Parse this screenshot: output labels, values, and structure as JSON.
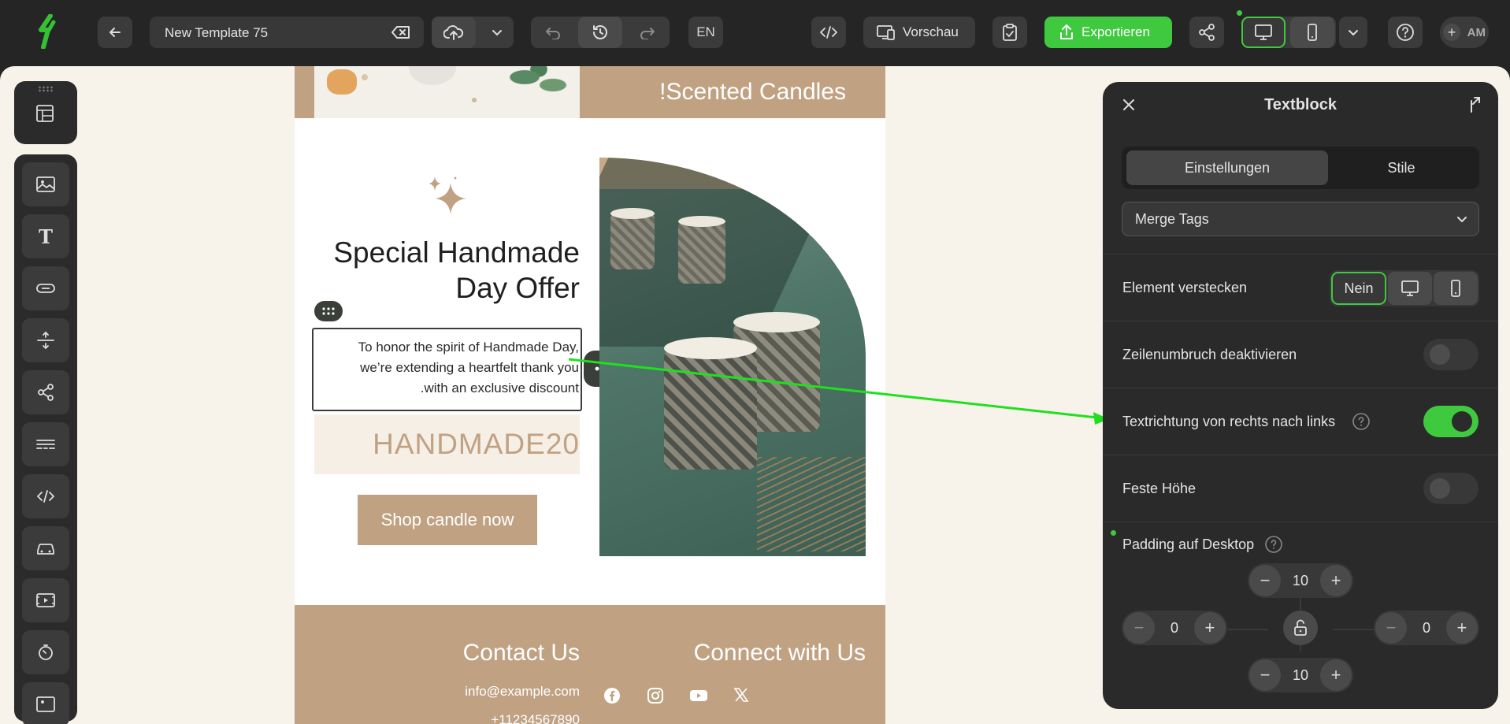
{
  "toolbar": {
    "template_name": "New Template 75",
    "language": "EN",
    "preview_label": "Vorschau",
    "export_label": "Exportieren",
    "user_initials": "AM"
  },
  "email": {
    "banner_title": "!Scented Candles",
    "headline": [
      "Special Handmade",
      "Day Offer"
    ],
    "body_lines": [
      "To honor the spirit of Handmade Day,",
      "we’re extending a heartfelt thank you",
      ".with an exclusive discount"
    ],
    "coupon_code": "HANDMADE20",
    "cta_label": "Shop candle now",
    "contact_title": "Contact Us",
    "contact_email": "info@example.com",
    "contact_phone": "+11234567890",
    "connect_title": "Connect with Us",
    "social_icons": [
      "facebook-icon",
      "instagram-icon",
      "youtube-icon",
      "x-icon"
    ]
  },
  "colors": {
    "accent_green": "#3fc93f",
    "email_tan": "#c0a283",
    "coupon_bg": "#f6efe6",
    "coupon_text": "#c0a283",
    "arrow_green": "#1fe01f"
  },
  "panel": {
    "title": "Textblock",
    "tabs": [
      "Einstellungen",
      "Stile"
    ],
    "active_tab": "Einstellungen",
    "merge_tags_label": "Merge Tags",
    "hide_element_label": "Element verstecken",
    "hide_element_options": [
      "Nein",
      "desktop-icon",
      "mobile-icon"
    ],
    "hide_element_selected": "Nein",
    "disable_linebreak_label": "Zeilenumbruch deaktivieren",
    "disable_linebreak_value": false,
    "rtl_label": "Textrichtung von rechts nach links",
    "rtl_value": true,
    "fixed_height_label": "Feste Höhe",
    "fixed_height_value": false,
    "padding_label": "Padding auf Desktop",
    "padding_top": "10",
    "padding_left": "0",
    "padding_right": "0",
    "padding_bottom": "10"
  }
}
